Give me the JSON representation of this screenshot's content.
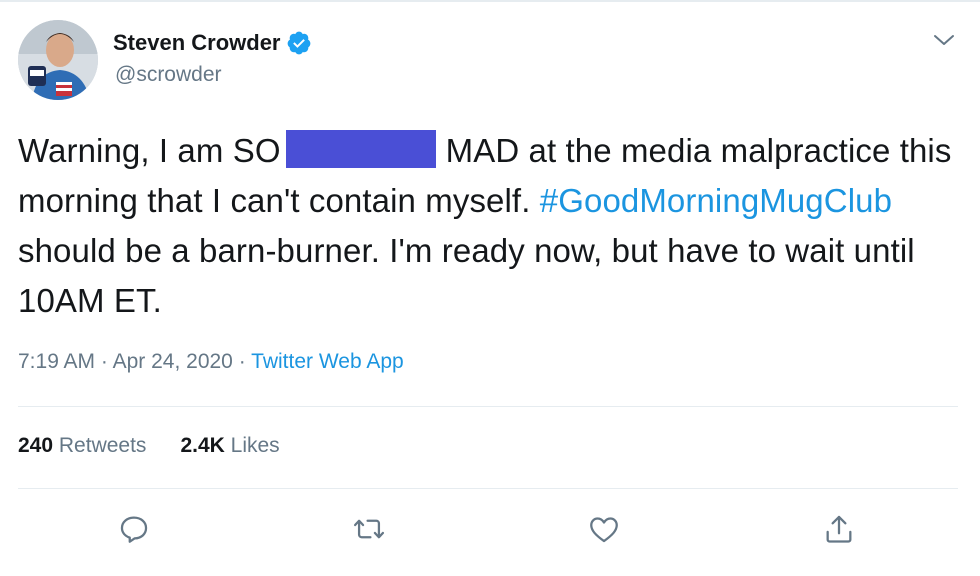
{
  "user": {
    "display_name": "Steven Crowder",
    "handle": "@scrowder",
    "verified": true
  },
  "tweet": {
    "text_part1": "Warning, I am SO",
    "text_part2": "MAD at the media malpractice this morning that I can't contain myself.",
    "hashtag": "#GoodMorningMugClub",
    "text_part3": "should be a barn-burner. I'm ready now, but have to wait until 10AM ET."
  },
  "meta": {
    "time": "7:19 AM",
    "separator": "·",
    "date": "Apr 24, 2020",
    "source": "Twitter Web App"
  },
  "stats": {
    "retweets_count": "240",
    "retweets_label": "Retweets",
    "likes_count": "2.4K",
    "likes_label": "Likes"
  },
  "actions": [
    "reply-icon",
    "retweet-icon",
    "like-icon",
    "share-icon"
  ],
  "colors": {
    "link": "#1b95e0",
    "secondary_text": "#657786",
    "verified_badge": "#1da1f2",
    "redaction_box": "#4a4fd6"
  }
}
